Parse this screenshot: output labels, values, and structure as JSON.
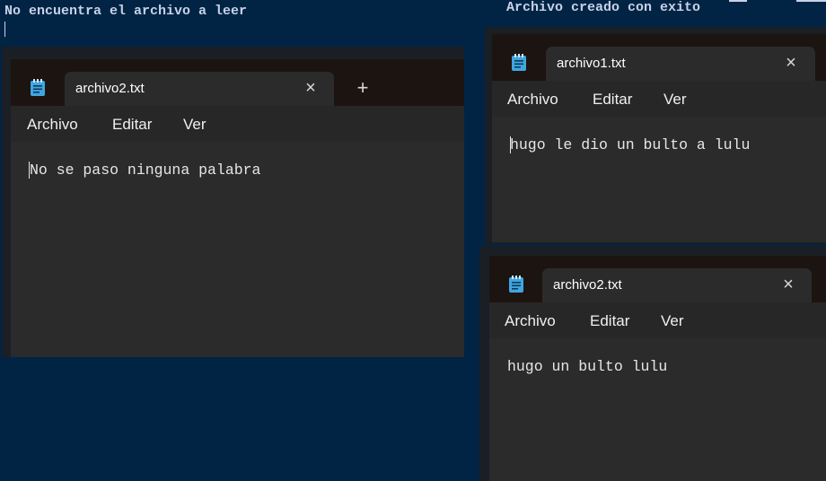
{
  "terminal": {
    "left_message": "No encuentra el archivo a leer",
    "right_message": "Archivo creado con exito"
  },
  "windows": [
    {
      "id": "notepad-left",
      "tab_title": "archivo2.txt",
      "menu": [
        "Archivo",
        "Editar",
        "Ver"
      ],
      "content": "No se paso ninguna palabra"
    },
    {
      "id": "notepad-top-right",
      "tab_title": "archivo1.txt",
      "menu": [
        "Archivo",
        "Editar",
        "Ver"
      ],
      "content": "hugo le dio un bulto a lulu"
    },
    {
      "id": "notepad-bottom-right",
      "tab_title": "archivo2.txt",
      "menu": [
        "Archivo",
        "Editar",
        "Ver"
      ],
      "content": "hugo un bulto lulu"
    }
  ],
  "icons": {
    "app": "notepad-icon",
    "close": "close-icon",
    "new_tab": "plus-icon"
  },
  "colors": {
    "terminal_bg": "#012445",
    "window_bg": "#2b2b2b",
    "titlebar_bg": "#1c1410",
    "icon_blue": "#3fa6e0"
  }
}
